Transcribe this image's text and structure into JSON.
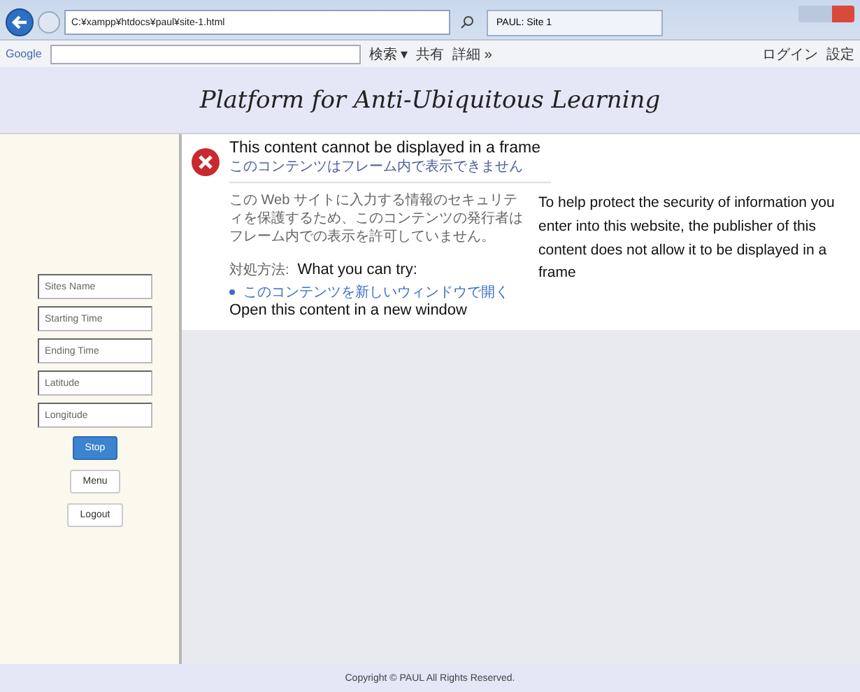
{
  "browser": {
    "address": "C:¥xampp¥htdocs¥paul¥site-1.html",
    "tab_title": "PAUL: Site 1",
    "toolbar": {
      "search_label": "Google",
      "buttons": [
        "検索 ▾",
        "共有",
        "詳細 »"
      ],
      "login": "ログイン",
      "settings": "設定"
    }
  },
  "header": {
    "title": "Platform for Anti-Ubiquitous Learning"
  },
  "sidebar": {
    "fields": [
      {
        "placeholder": "Sites Name"
      },
      {
        "placeholder": "Starting Time"
      },
      {
        "placeholder": "Ending Time"
      },
      {
        "placeholder": "Latitude"
      },
      {
        "placeholder": "Longitude"
      }
    ],
    "buttons": [
      {
        "label": "Stop",
        "kind": "primary"
      },
      {
        "label": "Menu",
        "kind": "default"
      },
      {
        "label": "Logout",
        "kind": "default"
      }
    ]
  },
  "frame_error": {
    "title": "This content cannot be displayed in a frame",
    "title_ja": "このコンテンツはフレーム内で表示できません",
    "body_ja": "この Web サイトに入力する情報のセキュリティを保護するため、このコンテンツの発行者はフレーム内での表示を許可していません。",
    "body_en": "To help protect the security of information you enter into this website, the publisher of this content does not allow it to be displayed in a frame",
    "try_ja": "対処方法:",
    "try_en": "What you can try:",
    "link_ja": "このコンテンツを新しいウィンドウで開く",
    "link_en": "Open this content in a new window"
  },
  "footer": {
    "text": "Copyright © PAUL All Rights Reserved."
  }
}
